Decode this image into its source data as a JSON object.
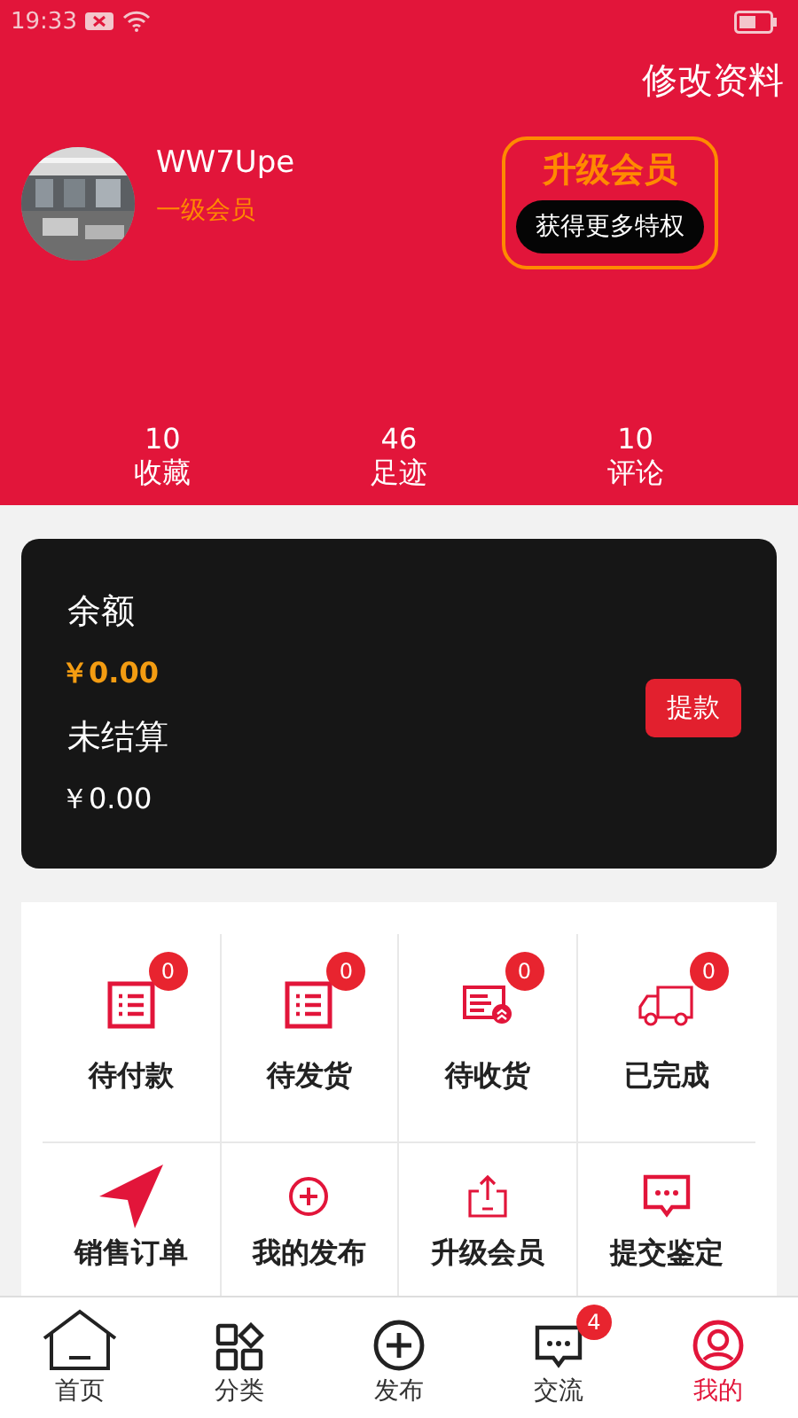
{
  "status_bar": {
    "time": "19:33"
  },
  "header": {
    "edit_link": "修改资料",
    "username": "WW7Upe",
    "member_level": "一级会员",
    "upgrade": {
      "title": "升级会员",
      "button": "获得更多特权"
    }
  },
  "stats": [
    {
      "value": "10",
      "label": "收藏"
    },
    {
      "value": "46",
      "label": "足迹"
    },
    {
      "value": "10",
      "label": "评论"
    }
  ],
  "wallet": {
    "balance_label": "余额",
    "balance": "￥0.00",
    "pending_label": "未结算",
    "pending": "￥0.00",
    "withdraw_button": "提款"
  },
  "orders": [
    {
      "label": "待付款",
      "badge": "0"
    },
    {
      "label": "待发货",
      "badge": "0"
    },
    {
      "label": "待收货",
      "badge": "0"
    },
    {
      "label": "已完成",
      "badge": "0"
    },
    {
      "label": "销售订单"
    },
    {
      "label": "我的发布"
    },
    {
      "label": "升级会员"
    },
    {
      "label": "提交鉴定"
    }
  ],
  "tab_bar": [
    {
      "label": "首页",
      "selected": false
    },
    {
      "label": "分类",
      "selected": false
    },
    {
      "label": "发布",
      "selected": false
    },
    {
      "label": "交流",
      "selected": false,
      "badge": "4"
    },
    {
      "label": "我的",
      "selected": true
    }
  ]
}
